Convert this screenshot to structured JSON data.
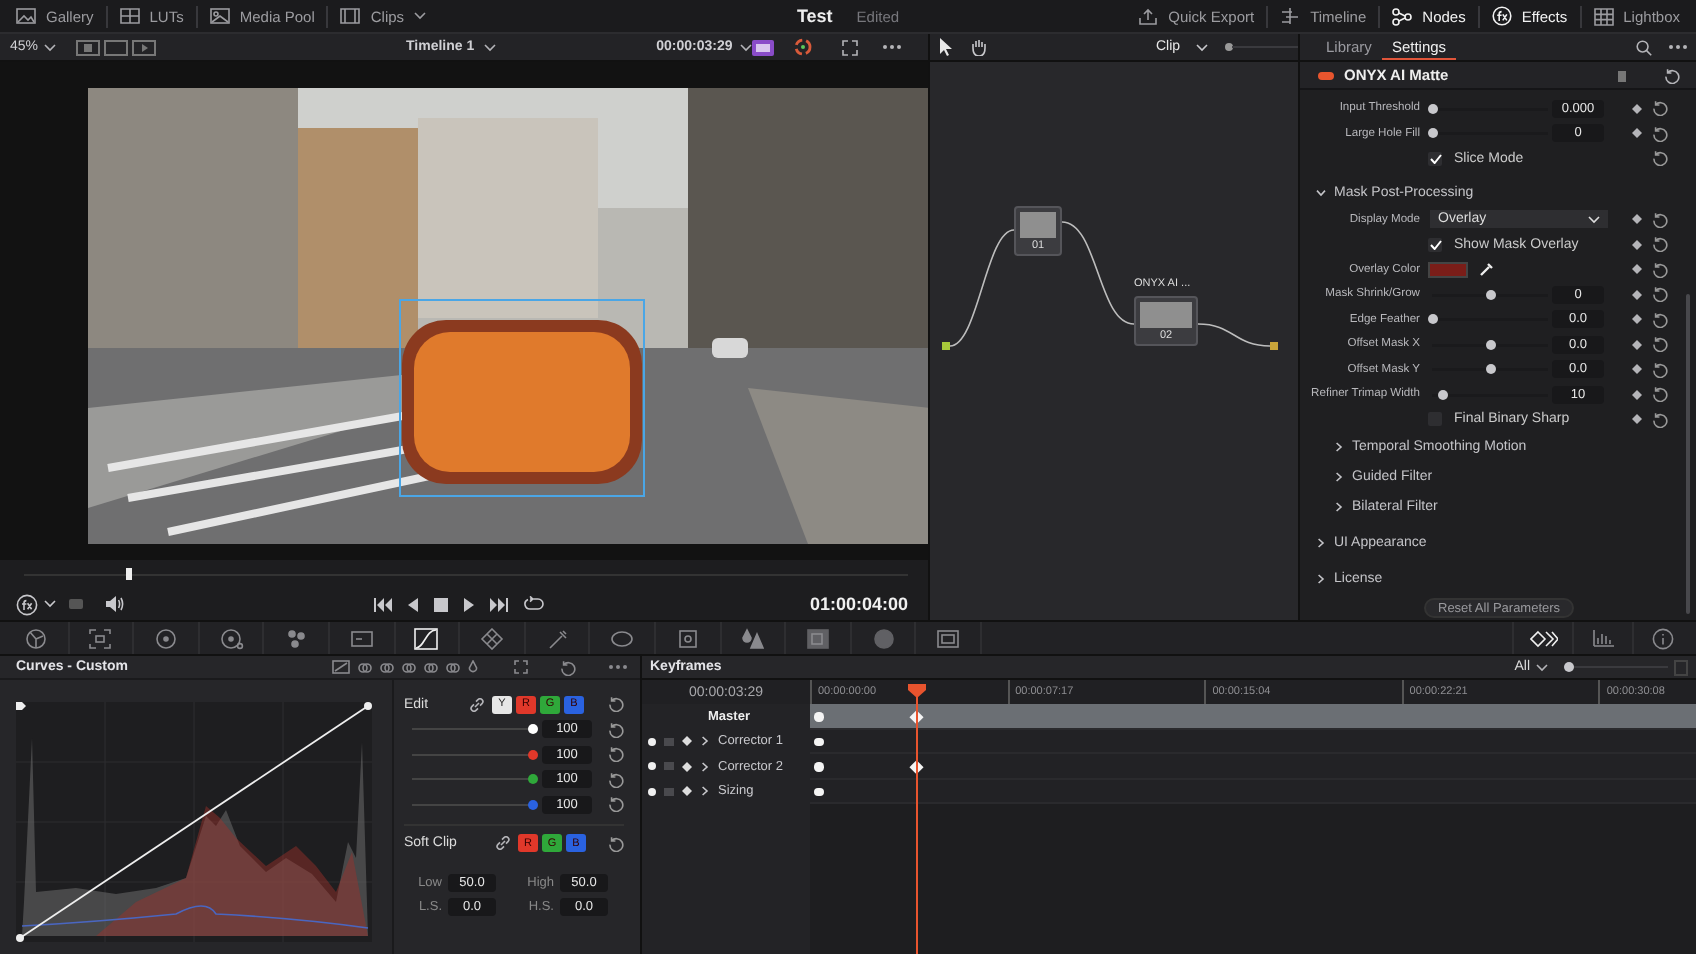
{
  "top_bar": {
    "left": [
      {
        "kind": "gallery",
        "label": "Gallery",
        "selected": false
      },
      {
        "kind": "luts",
        "label": "LUTs",
        "selected": false
      },
      {
        "kind": "media-pool",
        "label": "Media Pool",
        "selected": false
      },
      {
        "kind": "clips",
        "label": "Clips",
        "selected": false
      }
    ],
    "project": "Test",
    "status": "Edited",
    "right": [
      {
        "kind": "quick-export",
        "label": "Quick Export",
        "selected": false
      },
      {
        "kind": "timeline",
        "label": "Timeline",
        "selected": false
      },
      {
        "kind": "nodes",
        "label": "Nodes",
        "selected": true
      },
      {
        "kind": "effects",
        "label": "Effects",
        "selected": true
      },
      {
        "kind": "lightbox",
        "label": "Lightbox",
        "selected": false
      }
    ]
  },
  "viewer": {
    "zoom": "45%",
    "timeline": "Timeline 1",
    "timecode": "00:00:03:29",
    "scrubber": {
      "level": 0.12
    },
    "playhead_timecode": "01:00:04:00"
  },
  "node_editor": {
    "mode": "Clip",
    "nodes": [
      {
        "label": "01"
      },
      {
        "title": "ONYX AI ...",
        "label": "02"
      }
    ]
  },
  "settings": {
    "tabs": [
      {
        "label": "Library",
        "selected": false
      },
      {
        "label": "Settings",
        "selected": true
      }
    ],
    "effect": {
      "name": "ONYX AI Matte",
      "enabled": true
    },
    "params": [
      {
        "kind": "slider",
        "label": "Input Threshold",
        "level": 0,
        "value": "0.000",
        "keyframe": true
      },
      {
        "kind": "slider",
        "label": "Large Hole Fill",
        "level": 0,
        "value": "0",
        "keyframe": true
      },
      {
        "kind": "checkbox",
        "label": "Slice Mode",
        "checked": true,
        "keyframe": false
      }
    ],
    "sections": [
      {
        "label": "Mask Post-Processing",
        "expanded": true,
        "params": [
          {
            "kind": "dropdown",
            "label": "Display Mode",
            "value": "Overlay",
            "keyframe": true
          },
          {
            "kind": "checkbox",
            "label": "Show Mask Overlay",
            "checked": true,
            "keyframe": true
          },
          {
            "kind": "color",
            "label": "Overlay Color",
            "color": "#7a1d18",
            "keyframe": true
          },
          {
            "kind": "slider",
            "label": "Mask Shrink/Grow",
            "level": 0.5,
            "value": "0",
            "keyframe": true
          },
          {
            "kind": "slider",
            "label": "Edge Feather",
            "level": 0,
            "value": "0.0",
            "keyframe": true
          },
          {
            "kind": "slider",
            "label": "Offset Mask X",
            "level": 0.5,
            "value": "0.0",
            "keyframe": true
          },
          {
            "kind": "slider",
            "label": "Offset Mask Y",
            "level": 0.5,
            "value": "0.0",
            "keyframe": true
          },
          {
            "kind": "slider",
            "label": "Refiner Trimap Width",
            "level": 0.1,
            "value": "10",
            "keyframe": true
          },
          {
            "kind": "checkbox",
            "label": "Final Binary Sharp",
            "checked": false,
            "keyframe": true
          }
        ],
        "children": [
          {
            "label": "Temporal Smoothing Motion",
            "expanded": false
          },
          {
            "label": "Guided Filter",
            "expanded": false
          },
          {
            "label": "Bilateral Filter",
            "expanded": false
          }
        ]
      },
      {
        "label": "UI Appearance",
        "expanded": false
      },
      {
        "label": "License",
        "expanded": false
      }
    ],
    "reset_button": "Reset All Parameters"
  },
  "tools": [
    {
      "kind": "camera-raw",
      "selected": false
    },
    {
      "kind": "color-match",
      "selected": false
    },
    {
      "kind": "primaries",
      "selected": false
    },
    {
      "kind": "hdr",
      "selected": false
    },
    {
      "kind": "rgb-mixer",
      "selected": false
    },
    {
      "kind": "motion",
      "selected": false
    },
    {
      "kind": "curves",
      "selected": true
    },
    {
      "kind": "warper",
      "selected": false
    },
    {
      "kind": "qualifier",
      "selected": false
    },
    {
      "kind": "window",
      "selected": false
    },
    {
      "kind": "tracker",
      "selected": false
    },
    {
      "kind": "magic-mask",
      "selected": false
    },
    {
      "kind": "blur",
      "selected": false
    },
    {
      "kind": "key",
      "selected": false
    },
    {
      "kind": "sizing",
      "selected": false
    }
  ],
  "view_tools": [
    {
      "kind": "keyframes",
      "selected": true
    },
    {
      "kind": "scopes",
      "selected": false
    },
    {
      "kind": "info",
      "selected": false
    }
  ],
  "curves": {
    "title": "Curves - Custom",
    "edit": {
      "label": "Edit",
      "channels": [
        {
          "label": "Y",
          "color": "#e6e6e6"
        },
        {
          "label": "R",
          "color": "#e0382a"
        },
        {
          "label": "G",
          "color": "#2fa83a"
        },
        {
          "label": "B",
          "color": "#2a62e0"
        }
      ],
      "sliders": [
        {
          "color": "#ffffff",
          "level": 1,
          "value": "100"
        },
        {
          "color": "#e0382a",
          "level": 1,
          "value": "100"
        },
        {
          "color": "#2fa83a",
          "level": 1,
          "value": "100"
        },
        {
          "color": "#2a62e0",
          "level": 1,
          "value": "100"
        }
      ]
    },
    "soft_clip": {
      "label": "Soft Clip",
      "channels": [
        {
          "label": "R",
          "color": "#e0382a"
        },
        {
          "label": "G",
          "color": "#2fa83a"
        },
        {
          "label": "B",
          "color": "#2a62e0"
        }
      ],
      "fields": [
        {
          "label": "Low",
          "value": "50.0"
        },
        {
          "label": "High",
          "value": "50.0"
        },
        {
          "label": "L.S.",
          "value": "0.0"
        },
        {
          "label": "H.S.",
          "value": "0.0"
        }
      ]
    }
  },
  "keyframes": {
    "title": "Keyframes",
    "filter": "All",
    "zoom": {
      "level": 0.05
    },
    "timecode": "00:00:03:29",
    "ruler": [
      "00:00:00:00",
      "00:00:07:17",
      "00:00:15:04",
      "00:00:22:21",
      "00:00:30:08"
    ],
    "playhead": {
      "level": 0.12
    },
    "tracks": [
      {
        "kind": "master",
        "label": "Master",
        "selected": true,
        "keyframes": [
          {
            "kind": "start"
          },
          {
            "kind": "current"
          }
        ]
      },
      {
        "kind": "node",
        "label": "Corrector 1",
        "selected": false,
        "expanded": false,
        "keyframes": [
          {
            "kind": "start"
          }
        ]
      },
      {
        "kind": "node",
        "label": "Corrector 2",
        "selected": false,
        "expanded": false,
        "keyframes": [
          {
            "kind": "start"
          },
          {
            "kind": "current"
          }
        ]
      },
      {
        "kind": "node",
        "label": "Sizing",
        "selected": false,
        "expanded": false,
        "keyframes": [
          {
            "kind": "start"
          }
        ]
      }
    ]
  }
}
